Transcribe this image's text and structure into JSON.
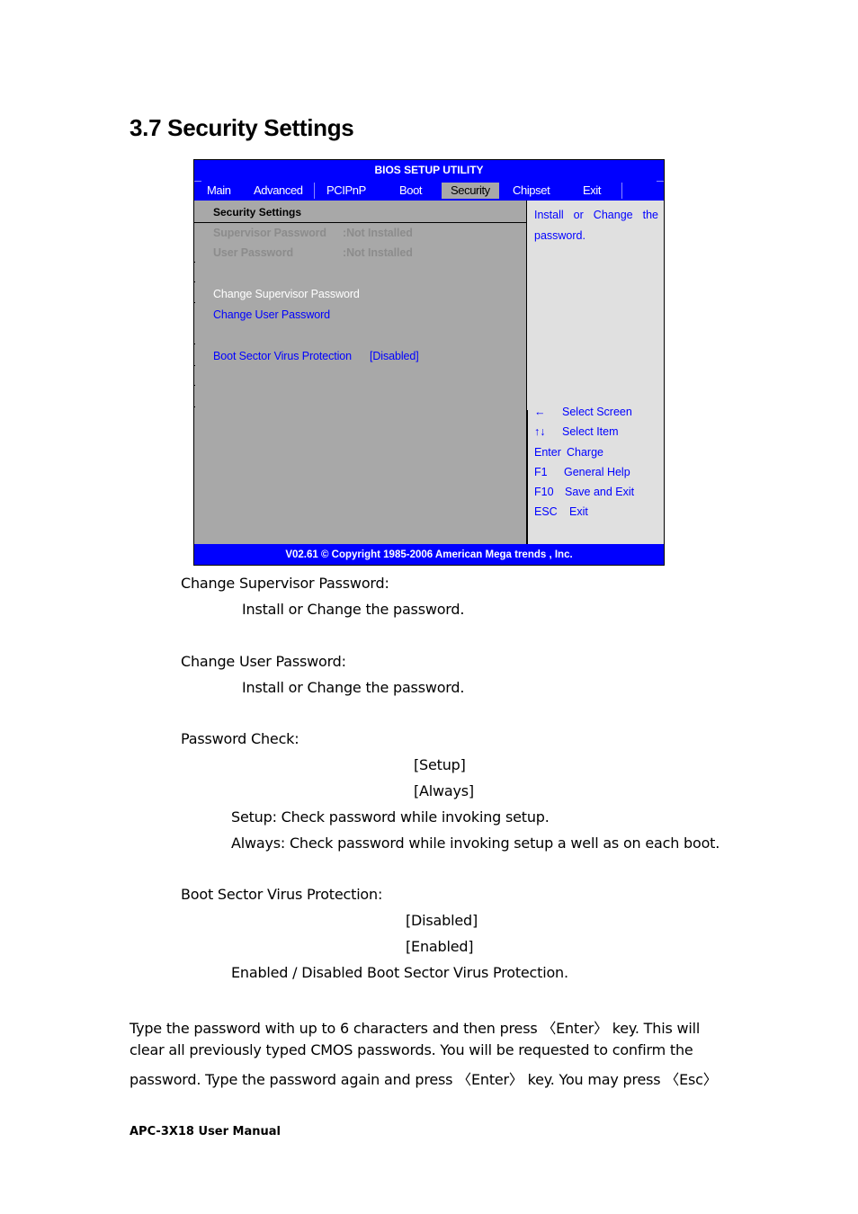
{
  "section": {
    "title": "3.7 Security Settings"
  },
  "bios": {
    "title": "BIOS SETUP UTILITY",
    "menu": [
      {
        "label": "Main",
        "active": false
      },
      {
        "label": "Advanced",
        "active": false
      },
      {
        "label": "PCIPnP",
        "active": false
      },
      {
        "label": "Boot",
        "active": false
      },
      {
        "label": "Security",
        "active": true
      },
      {
        "label": "Chipset",
        "active": false
      },
      {
        "label": "Exit",
        "active": false
      }
    ],
    "left": {
      "heading": "Security Settings",
      "status": [
        {
          "label": "Supervisor Password",
          "value": ":Not Installed"
        },
        {
          "label": "User Password",
          "value": ":Not Installed"
        }
      ],
      "items": [
        {
          "label": "Change Supervisor Password",
          "state": "selected"
        },
        {
          "label": "Change User Password",
          "state": "normal"
        },
        {
          "label": "Boot Sector Virus Protection",
          "value": "[Disabled]",
          "state": "normal"
        }
      ]
    },
    "right": {
      "help_text": "Install or Change the password.",
      "keys": [
        {
          "key": "←",
          "icon": "left-arrow-icon",
          "desc": "Select Screen"
        },
        {
          "key": "↑↓",
          "icon": "up-down-arrows-icon",
          "desc": "Select Item"
        },
        {
          "key": "Enter",
          "desc": "Charge"
        },
        {
          "key": "F1",
          "desc": "General Help"
        },
        {
          "key": "F10",
          "desc": "Save and Exit"
        },
        {
          "key": "ESC",
          "desc": "Exit"
        }
      ]
    },
    "footer": "V02.61 © Copyright 1985-2006 American Mega trends , Inc.",
    "colors": {
      "blue": "#0000ff",
      "panel_gray": "#a8a8a8",
      "help_gray": "#e0e0e0",
      "disabled_text": "#8c8c8c",
      "selected_text": "#ffffff"
    }
  },
  "doc": {
    "change_supervisor": {
      "label": "Change Supervisor Password:",
      "desc": "Install or Change the password."
    },
    "change_user": {
      "label": "Change User Password:",
      "desc": "Install or Change the password."
    },
    "password_check": {
      "label": "Password Check:",
      "options": [
        "[Setup]",
        "[Always]"
      ],
      "desc": [
        "Setup: Check password while invoking setup.",
        "Always: Check password while invoking setup a well as on each boot."
      ]
    },
    "boot_sector": {
      "label": "Boot Sector Virus Protection:",
      "options": [
        "[Disabled]",
        "[Enabled]"
      ],
      "desc": "Enabled / Disabled Boot Sector Virus Protection."
    },
    "paragraph": [
      "Type the password with up to 6 characters and then press 〈Enter〉 key. This will",
      "clear all previously typed CMOS passwords. You will be requested to confirm the",
      "password. Type the password again and press 〈Enter〉 key. You may press 〈Esc〉"
    ],
    "footer": "APC-3X18 User Manual"
  }
}
